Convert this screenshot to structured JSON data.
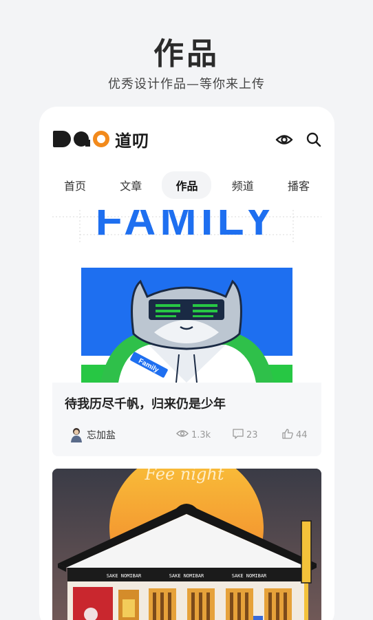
{
  "page": {
    "title": "作品",
    "subtitle": "优秀设计作品—等你来上传"
  },
  "app": {
    "logo_mark": "DAO",
    "logo_text": "道叨"
  },
  "header_icons": [
    "eye-icon",
    "search-icon"
  ],
  "tabs": [
    {
      "label": "首页",
      "active": false
    },
    {
      "label": "文章",
      "active": false
    },
    {
      "label": "作品",
      "active": true
    },
    {
      "label": "频道",
      "active": false
    },
    {
      "label": "播客",
      "active": false
    }
  ],
  "works": [
    {
      "artwork_text": "FAMILY",
      "badge_text": "Family",
      "title": "待我历尽千帆，归来仍是少年",
      "author": "忘加盐",
      "views": "1.3k",
      "comments": "23",
      "likes": "44"
    },
    {
      "artwork_script": "Fee night",
      "sign_labels": [
        "SAKE NOMIBAR",
        "SAKE NOMIBAR",
        "SAKE NOMIBAR"
      ]
    }
  ],
  "colors": {
    "accent_orange": "#f28a1c",
    "artwork_blue": "#1e6ff0",
    "artwork_green": "#27c744"
  }
}
